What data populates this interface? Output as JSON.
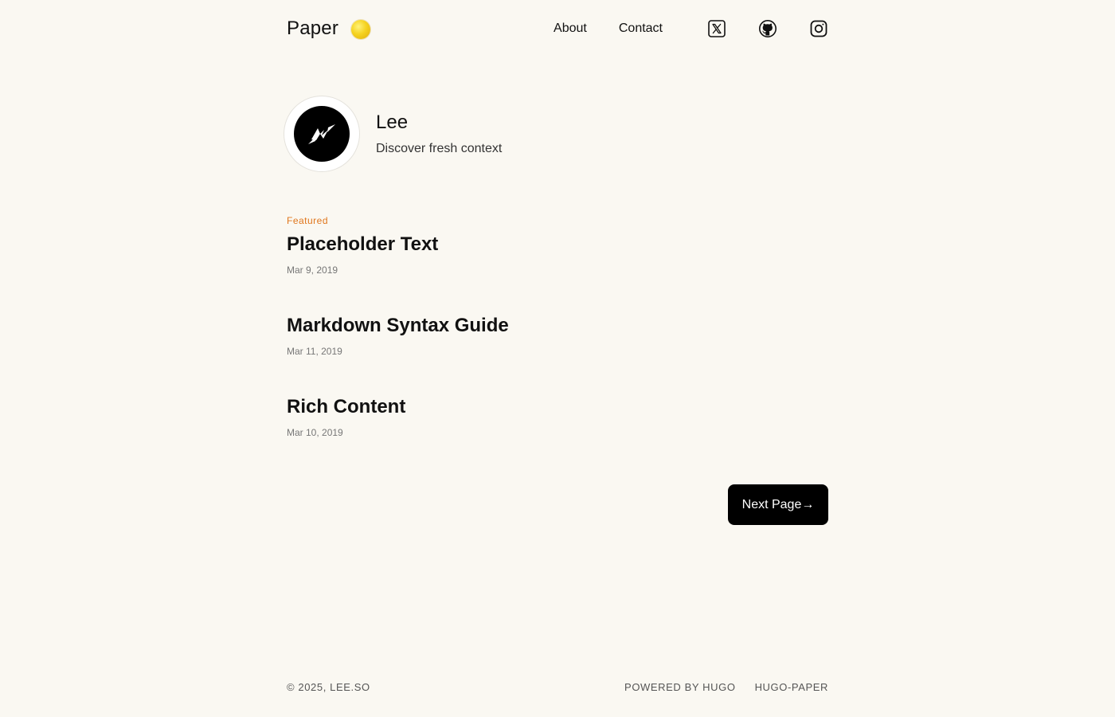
{
  "header": {
    "brand": "Paper",
    "nav": [
      {
        "label": "About"
      },
      {
        "label": "Contact"
      }
    ],
    "social": [
      {
        "icon": "x-twitter-icon"
      },
      {
        "icon": "github-icon"
      },
      {
        "icon": "instagram-icon"
      }
    ]
  },
  "profile": {
    "name": "Lee",
    "bio": "Discover fresh context"
  },
  "posts": [
    {
      "badge": "Featured",
      "title": "Placeholder Text",
      "date": "Mar 9, 2019"
    },
    {
      "title": "Markdown Syntax Guide",
      "date": "Mar 11, 2019"
    },
    {
      "title": "Rich Content",
      "date": "Mar 10, 2019"
    }
  ],
  "pagination": {
    "next_label": "Next Page→"
  },
  "footer": {
    "copyright": "© 2025, LEE.SO",
    "links": [
      {
        "label": "POWERED BY HUGO"
      },
      {
        "label": "HUGO-PAPER"
      }
    ]
  },
  "colors": {
    "background": "#faf8f2",
    "text": "#111111",
    "featured": "#e0761c",
    "button": "#000000",
    "theme_toggle": "#f5d321"
  }
}
